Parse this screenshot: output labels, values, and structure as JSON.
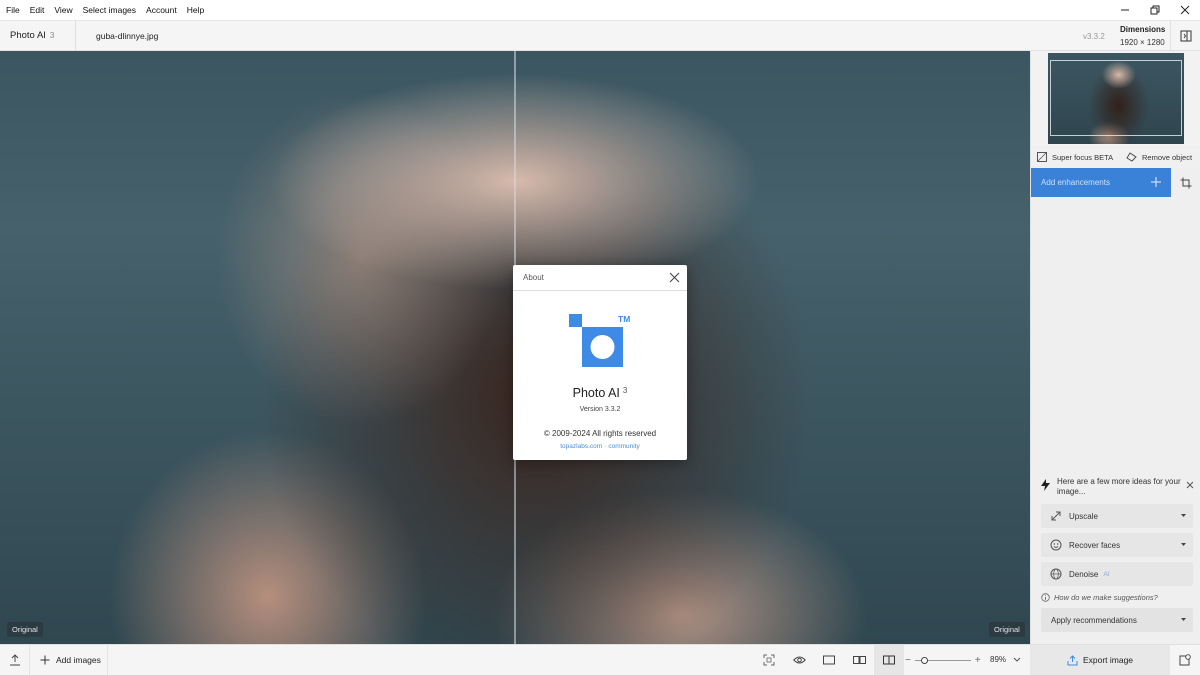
{
  "menu": [
    "File",
    "Edit",
    "View",
    "Select images",
    "Account",
    "Help"
  ],
  "header": {
    "app_name": "Photo AI",
    "app_version_sup": "3",
    "file_name": "guba-dlinnye.jpg",
    "version": "v3.3.2",
    "dimensions_label": "Dimensions",
    "dimensions_value": "1920 × 1280"
  },
  "canvas": {
    "original_left": "Original",
    "original_right": "Original"
  },
  "about": {
    "title": "About",
    "trademark": "TM",
    "app_name": "Photo AI",
    "app_sup": "3",
    "version": "Version 3.3.2",
    "copyright": "© 2009-2024 All rights reserved",
    "link_site": "topazlabs.com",
    "link_sep": "·",
    "link_community": "community",
    "accent_color": "#3d8be6"
  },
  "panel": {
    "super_focus": "Super focus BETA",
    "remove_object": "Remove object",
    "add_enhancements": "Add enhancements",
    "ideas_text": "Here are a few more ideas for your image...",
    "suggestions": [
      {
        "label": "Upscale",
        "icon": "upscale-icon",
        "extra": ""
      },
      {
        "label": "Recover faces",
        "icon": "face-icon",
        "extra": ""
      },
      {
        "label": "Denoise",
        "icon": "denoise-icon",
        "extra": "AI"
      }
    ],
    "how_text": "How do we make suggestions?",
    "apply_label": "Apply recommendations"
  },
  "bottom": {
    "add_images": "Add images",
    "zoom_minus": "−",
    "zoom_plus": "+",
    "zoom_value": "89%",
    "zoom_level": 0.12,
    "export_label": "Export image"
  }
}
